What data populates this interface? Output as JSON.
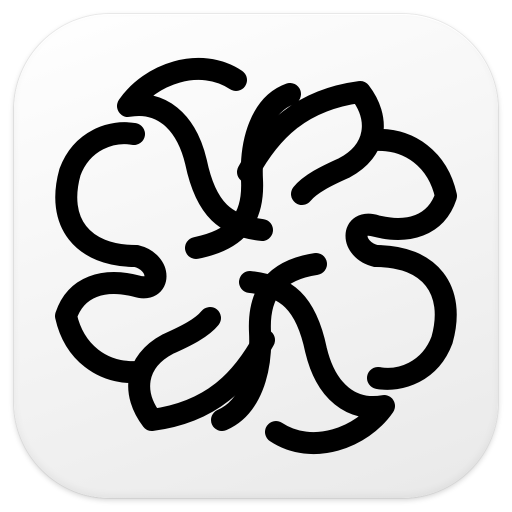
{
  "icon": {
    "name": "celtic-knot-icon",
    "background_color": "#f3f3f3",
    "stroke_color": "#000000"
  }
}
